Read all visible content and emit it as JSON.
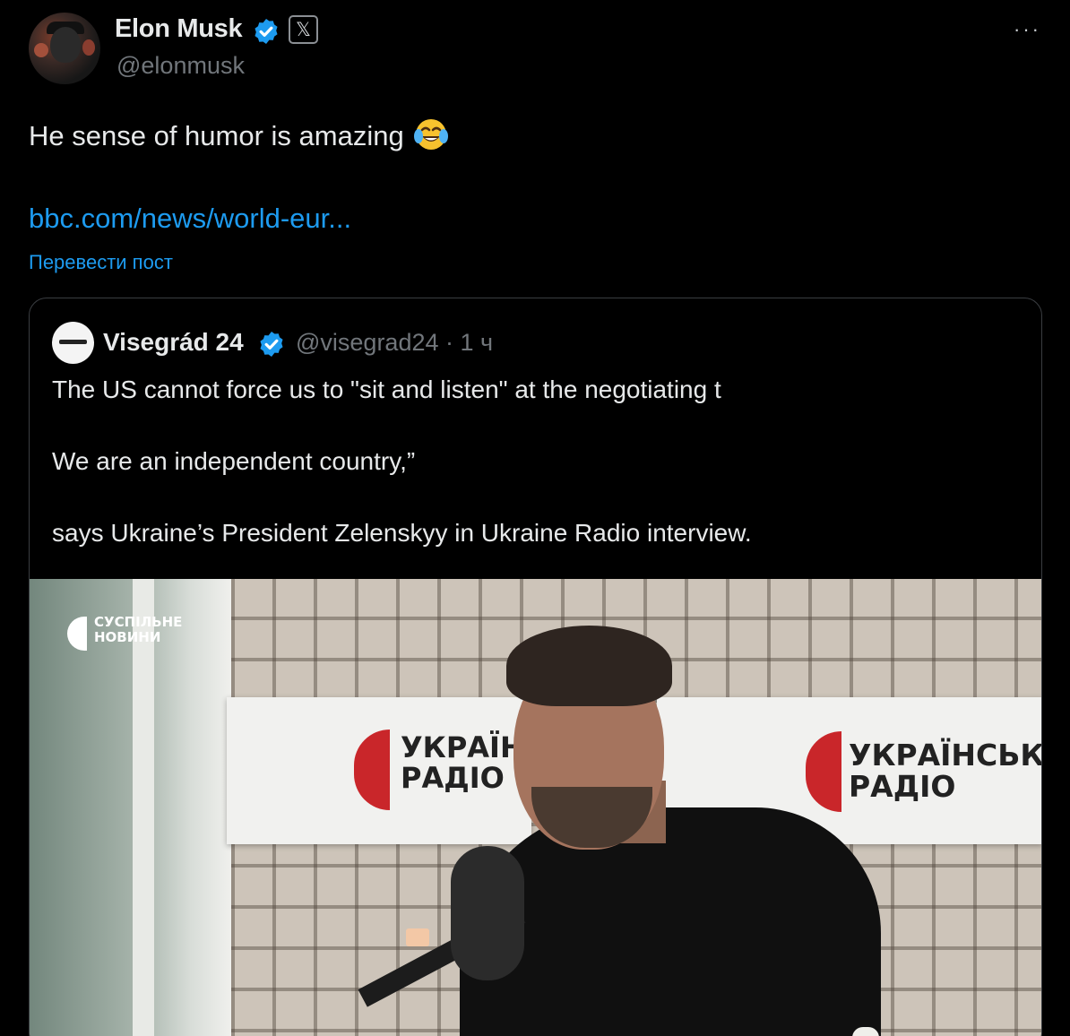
{
  "author": {
    "name": "Elon Musk",
    "handle": "@elonmusk",
    "verified": true,
    "affiliate_badge": "𝕏"
  },
  "more_menu": "···",
  "post": {
    "text": "He sense of humor is amazing",
    "emoji": "face-with-tears-of-joy",
    "link": "bbc.com/news/world-eur...",
    "translate_label": "Перевести пост"
  },
  "quoted": {
    "name": "Visegrád 24",
    "handle_time": "@visegrad24 · 1 ч",
    "lines": [
      "The US cannot force us to \"sit and listen\" at the negotiating t",
      "We are an independent country,”",
      "says Ukraine’s President Zelenskyy in Ukraine Radio interview."
    ],
    "image": {
      "watermark_line1": "СУСПІЛЬНЕ",
      "watermark_line2": "НОВИНИ",
      "banner_left_line1": "УКРАЇН",
      "banner_left_line2": "РАДІО",
      "banner_right_line1": "УКРАЇНСЬКЕ",
      "banner_right_line2": "РАДІО"
    }
  },
  "colors": {
    "background": "#000000",
    "text": "#e7e9ea",
    "muted": "#71767b",
    "link": "#1d9bf0",
    "border": "#3a3d41"
  }
}
